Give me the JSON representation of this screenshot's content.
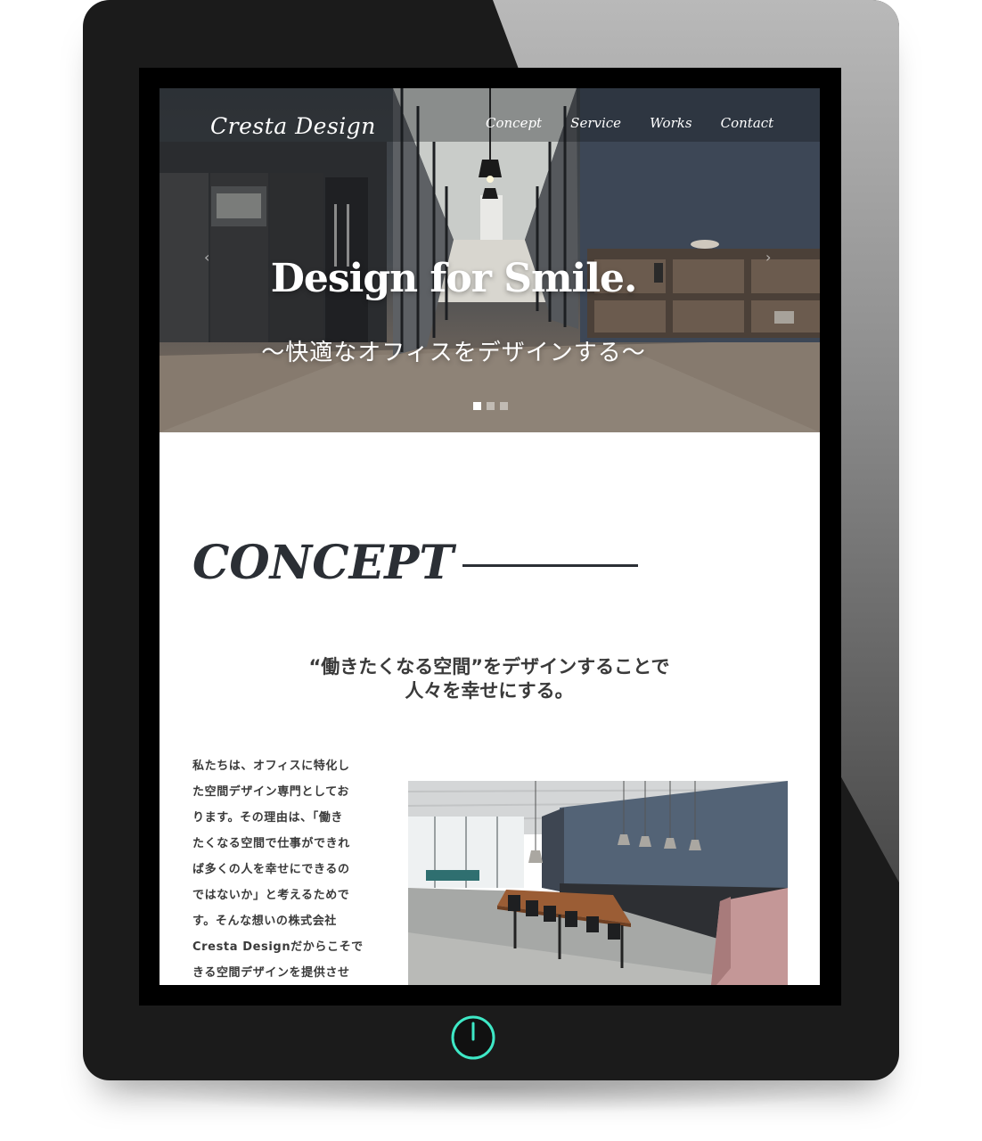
{
  "site": {
    "logo": "Cresta Design",
    "nav": [
      "Concept",
      "Service",
      "Works",
      "Contact"
    ]
  },
  "hero": {
    "title": "Design for Smile.",
    "subtitle": "〜快適なオフィスをデザインする〜",
    "prev_arrow": "‹",
    "next_arrow": "›",
    "slide_count": 3,
    "active_slide": 1
  },
  "concept": {
    "heading": "CONCEPT",
    "lead": [
      "“働きたくなる空間”をデザインすることで",
      "人々を幸せにする。"
    ],
    "body_lines": [
      "私たちは、オフィスに特化し",
      "た空間デザイン専門としてお",
      "ります。その理由は、「働き",
      "たくなる空間で仕事ができれ",
      "ば多くの人を幸せにできるの",
      "ではないか」と考えるためで",
      "す。そんな想いの株式会社",
      "Cresta Designだからこそで",
      "きる空間デザインを提供させ"
    ]
  },
  "icons": {
    "power": "power-icon",
    "accent_color": "#3ee8c6"
  }
}
